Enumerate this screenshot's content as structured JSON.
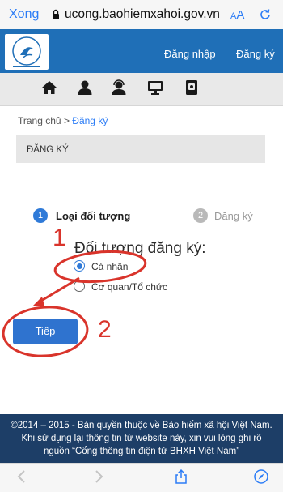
{
  "browser": {
    "done_label": "Xong",
    "url": "ucong.baohiemxahoi.gov.vn",
    "aa_label_small": "A",
    "aa_label_large": "A"
  },
  "header": {
    "login_label": "Đăng nhập",
    "register_label": "Đăng ký"
  },
  "icon_nav": [
    "home-icon",
    "user-icon",
    "support-icon",
    "monitor-icon",
    "document-icon"
  ],
  "breadcrumb": {
    "home": "Trang chủ",
    "separator": ">",
    "current": "Đăng ký"
  },
  "section": {
    "title": "ĐĂNG KÝ"
  },
  "steps": [
    {
      "number": "1",
      "label": "Loại đối tượng"
    },
    {
      "number": "2",
      "label": "Đăng ký"
    }
  ],
  "annotations": {
    "one": "1",
    "two": "2"
  },
  "form": {
    "heading": "Đối tượng đăng ký:",
    "options": [
      {
        "label": "Cá nhân"
      },
      {
        "label": "Cơ quan/Tổ chức"
      }
    ],
    "next_button": "Tiếp"
  },
  "footer": {
    "line1": "©2014 – 2015 - Bản quyền thuộc về Bảo hiểm xã hội Việt Nam.",
    "line2": "Khi sử dụng lại thông tin từ website này, xin vui lòng ghi rõ",
    "line3": "nguồn “Cổng thông tin điện tử BHXH Việt Nam”"
  },
  "colors": {
    "header_blue": "#1f6fb7",
    "footer_navy": "#1d3e67",
    "accent_blue": "#2f7ad8",
    "annotation_red": "#d9342b"
  }
}
